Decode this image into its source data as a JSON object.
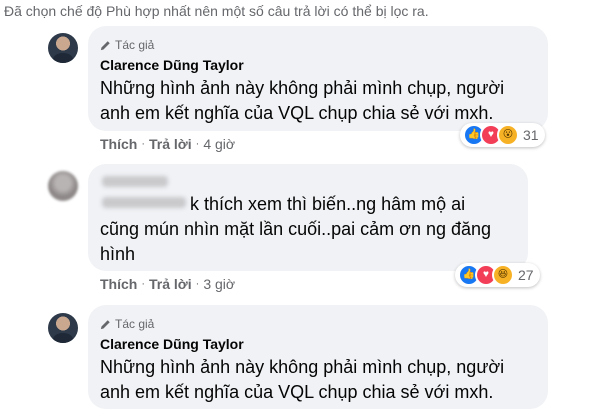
{
  "filter_note": "Đã chọn chế độ Phù hợp nhất nên một số câu trả lời có thể bị lọc ra.",
  "comments": [
    {
      "author_badge": "Tác giả",
      "name": "Clarence Dũng Taylor",
      "lines": [
        "Những hình ảnh này không phải mình chụp, người",
        "anh em kết nghĩa của VQL chụp chia sẻ với mxh."
      ],
      "like_label": "Thích",
      "reply_label": "Trả lời",
      "time": "4 giờ",
      "reaction_icons": [
        "like-icon",
        "love-icon",
        "wow-icon"
      ],
      "reaction_count": "31"
    },
    {
      "lines": [
        "k thích xem thì biến..ng hâm mộ ai",
        "cũng mún nhìn mặt lần cuối..pai cảm ơn ng đăng",
        "hình"
      ],
      "like_label": "Thích",
      "reply_label": "Trả lời",
      "time": "3 giờ",
      "reaction_icons": [
        "like-icon",
        "love-icon",
        "haha-icon"
      ],
      "reaction_count": "27"
    },
    {
      "author_badge": "Tác giả",
      "name": "Clarence Dũng Taylor",
      "lines": [
        "Những hình ảnh này không phải mình chụp, người",
        "anh em kết nghĩa của VQL chụp chia sẻ với mxh."
      ]
    }
  ]
}
